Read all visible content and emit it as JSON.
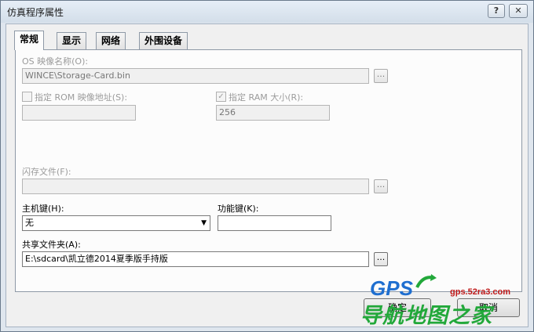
{
  "window": {
    "title": "仿真程序属性"
  },
  "title_buttons": {
    "help": "?",
    "close": "✕"
  },
  "tabs": [
    {
      "label": "常规",
      "active": true
    },
    {
      "label": "显示",
      "active": false
    },
    {
      "label": "网络",
      "active": false
    },
    {
      "label": "外围设备",
      "active": false
    }
  ],
  "general": {
    "os_image": {
      "label": "OS 映像名称(O):",
      "value": "WINCE\\Storage-Card.bin",
      "enabled": false
    },
    "rom_address": {
      "label": "指定 ROM 映像地址(S):",
      "checked": false,
      "enabled": false,
      "value": ""
    },
    "ram_size": {
      "label": "指定 RAM 大小(R):",
      "checked": true,
      "enabled": false,
      "value": "256"
    },
    "flash_file": {
      "label": "闪存文件(F):",
      "value": "",
      "enabled": false
    },
    "host_key": {
      "label": "主机键(H):",
      "selected": "无"
    },
    "function_key": {
      "label": "功能键(K):",
      "value": ""
    },
    "shared_folder": {
      "label": "共享文件夹(A):",
      "value": "E:\\sdcard\\凯立德2014夏季版手持版"
    },
    "browse_label": "..."
  },
  "footer": {
    "ok_label": "确定",
    "cancel_label": "取消"
  },
  "watermark": {
    "brand": "GPS",
    "site": "gps.52ra3.com",
    "tagline": "导航地图之家"
  }
}
